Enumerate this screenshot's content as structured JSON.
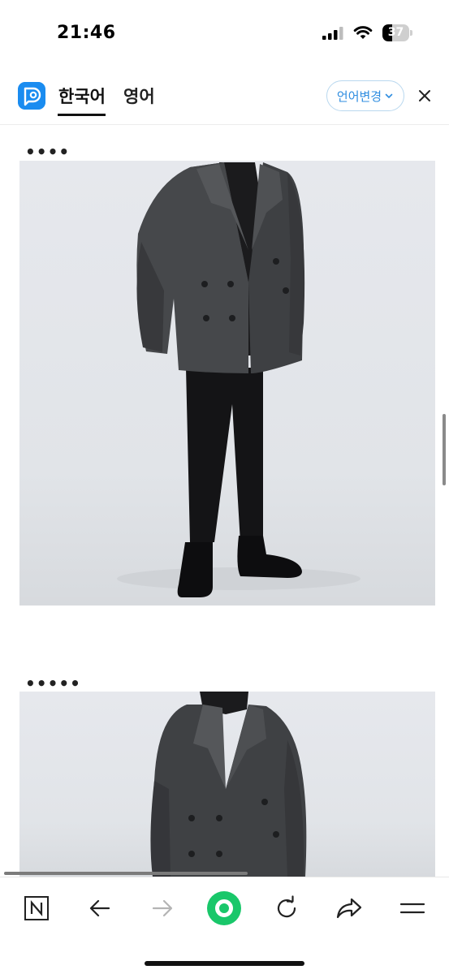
{
  "status_bar": {
    "time": "21:46",
    "battery_level": "37",
    "battery_fraction": 0.37,
    "icons": [
      "signal-icon",
      "wifi-icon",
      "battery-icon"
    ]
  },
  "translate_bar": {
    "logo_icon": "papago-logo-icon",
    "source_lang": "한국어",
    "target_lang": "영어",
    "change_button": "언어변경",
    "close_icon": "close-icon",
    "accent_color": "#2f8de0",
    "logo_color": "#1a8cf0"
  },
  "content": {
    "items": [
      {
        "caption": "••••"
      },
      {
        "caption": "•••••"
      }
    ]
  },
  "toolbar": {
    "items": [
      "naver-icon",
      "back-arrow-icon",
      "forward-arrow-icon",
      "green-dot-button-icon",
      "reload-icon",
      "share-icon",
      "menu-icon"
    ],
    "green_color": "#19c76a"
  }
}
